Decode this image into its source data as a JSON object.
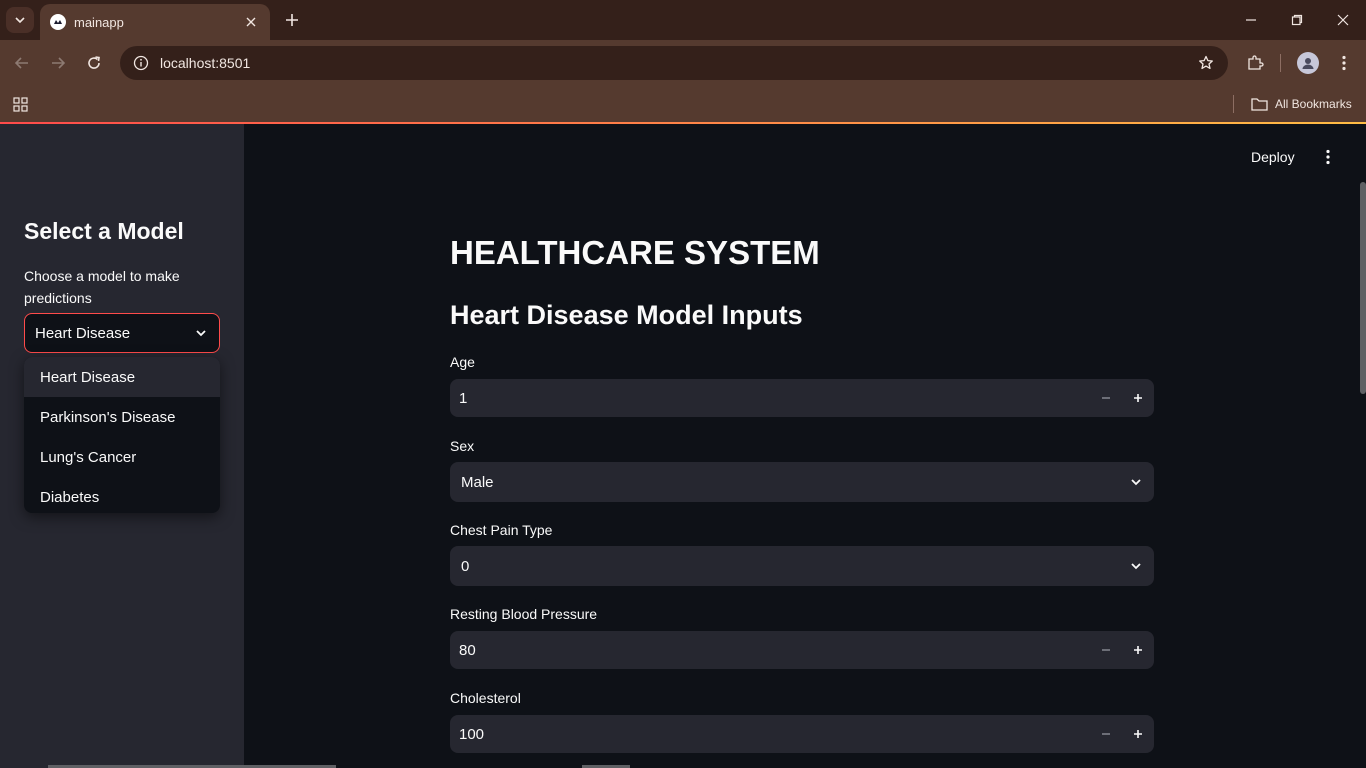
{
  "browser": {
    "tab_title": "mainapp",
    "url": "localhost:8501",
    "bookmarks_label": "All Bookmarks"
  },
  "sidebar": {
    "title": "Select a Model",
    "select_label": "Choose a model to make predictions",
    "selected_model": "Heart Disease",
    "options": [
      "Heart Disease",
      "Parkinson's Disease",
      "Lung's Cancer",
      "Diabetes"
    ]
  },
  "header": {
    "deploy_label": "Deploy"
  },
  "main": {
    "title": "HEALTHCARE SYSTEM",
    "subtitle": "Heart Disease Model Inputs",
    "fields": {
      "age": {
        "label": "Age",
        "value": "1"
      },
      "sex": {
        "label": "Sex",
        "value": "Male"
      },
      "chest_pain": {
        "label": "Chest Pain Type",
        "value": "0"
      },
      "rest_bp": {
        "label": "Resting Blood Pressure",
        "value": "80"
      },
      "cholesterol": {
        "label": "Cholesterol",
        "value": "100"
      }
    }
  },
  "colors": {
    "accent": "#ff4b4b",
    "app_bg": "#0e1117",
    "sidebar_bg": "#262730",
    "browser_chrome": "#553a2f"
  }
}
